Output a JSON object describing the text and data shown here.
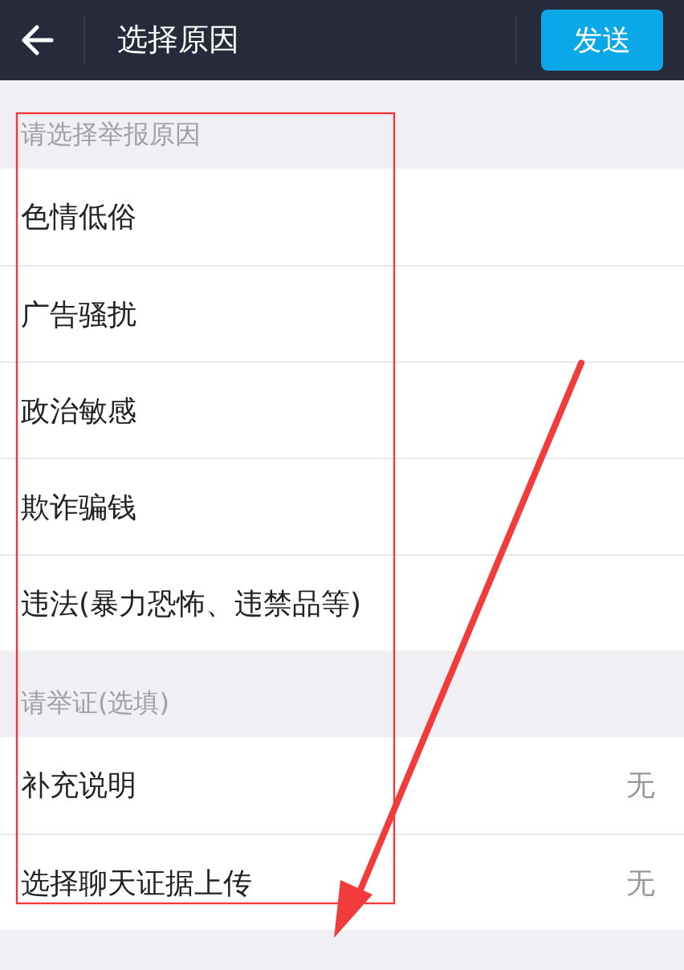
{
  "header": {
    "title": "选择原因",
    "send_button": "发送"
  },
  "sections": [
    {
      "title": "请选择举报原因",
      "items": [
        {
          "label": "色情低俗"
        },
        {
          "label": "广告骚扰"
        },
        {
          "label": "政治敏感"
        },
        {
          "label": "欺诈骗钱"
        },
        {
          "label": "违法(暴力恐怖、违禁品等)"
        }
      ]
    },
    {
      "title": "请举证(选填)",
      "items": [
        {
          "label": "补充说明",
          "value": "无"
        },
        {
          "label": "选择聊天证据上传",
          "value": "无"
        }
      ]
    }
  ]
}
